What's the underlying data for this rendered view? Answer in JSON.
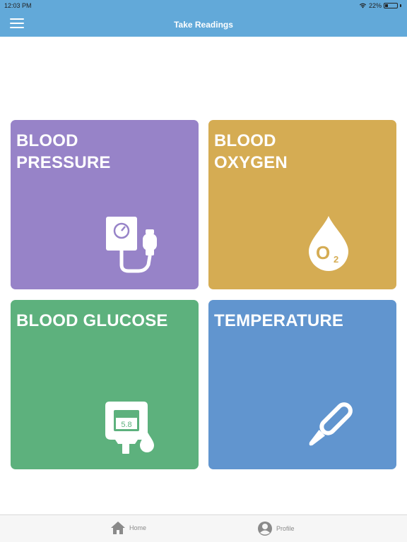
{
  "status_bar": {
    "time": "12:03 PM",
    "battery": "22%"
  },
  "header": {
    "title": "Take Readings",
    "menu_icon": "hamburger-menu-icon"
  },
  "tiles": [
    {
      "label": "BLOOD PRESSURE",
      "line1": "BLOOD",
      "line2": "PRESSURE",
      "icon": "blood-pressure-monitor-icon",
      "color": "#9783c8"
    },
    {
      "label": "BLOOD OXYGEN",
      "line1": "BLOOD",
      "line2": "OXYGEN",
      "icon": "oxygen-drop-icon",
      "color": "#d5ac53",
      "icon_text": "O",
      "icon_sub": "2"
    },
    {
      "label": "BLOOD GLUCOSE",
      "line1": "BLOOD GLUCOSE",
      "icon": "glucose-meter-icon",
      "color": "#5db17d",
      "icon_text": "5.8"
    },
    {
      "label": "TEMPERATURE",
      "line1": "TEMPERATURE",
      "icon": "thermometer-icon",
      "color": "#6195cf"
    }
  ],
  "tabbar": {
    "items": [
      {
        "label": "Home",
        "icon": "home-icon"
      },
      {
        "label": "Profile",
        "icon": "profile-icon"
      }
    ]
  },
  "colors": {
    "header": "#62a9d9",
    "tab_text": "#8a8a8a"
  }
}
